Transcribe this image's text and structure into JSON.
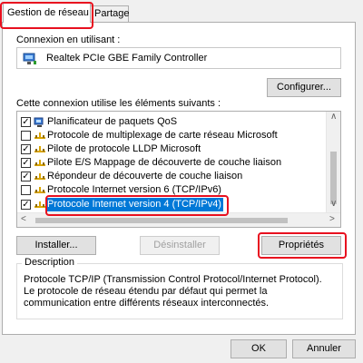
{
  "tabs": [
    {
      "label": "Gestion de réseau",
      "active": true
    },
    {
      "label": "Partage",
      "active": false
    }
  ],
  "connect_using": {
    "label": "Connexion en utilisant :",
    "adapter_name": "Realtek PCIe GBE Family Controller",
    "adapter_icon": "network-adapter-icon",
    "configure_button": "Configurer..."
  },
  "items": {
    "label": "Cette connexion utilise les éléments suivants :",
    "list": [
      {
        "label": "Planificateur de paquets QoS",
        "checked": true,
        "icon": "qos-scheduler-icon"
      },
      {
        "label": "Protocole de multiplexage de carte réseau Microsoft",
        "checked": false,
        "icon": "protocol-icon"
      },
      {
        "label": "Pilote de protocole LLDP Microsoft",
        "checked": true,
        "icon": "protocol-icon"
      },
      {
        "label": "Pilote E/S Mappage de découverte de couche liaison",
        "checked": true,
        "icon": "protocol-icon"
      },
      {
        "label": "Répondeur de découverte de couche liaison",
        "checked": true,
        "icon": "protocol-icon"
      },
      {
        "label": "Protocole Internet version 6 (TCP/IPv6)",
        "checked": false,
        "icon": "protocol-icon"
      },
      {
        "label": "Protocole Internet version 4 (TCP/IPv4)",
        "checked": true,
        "icon": "protocol-icon",
        "selected": true
      }
    ]
  },
  "actions": {
    "install": "Installer...",
    "uninstall": "Désinstaller",
    "properties": "Propriétés"
  },
  "description": {
    "title": "Description",
    "text": "Protocole TCP/IP (Transmission Control Protocol/Internet Protocol). Le protocole de réseau étendu par défaut qui permet la communication entre différents réseaux interconnectés."
  },
  "footer": {
    "ok": "OK",
    "cancel": "Annuler"
  },
  "colors": {
    "highlight": "#e8101f",
    "selection": "#0078d7"
  }
}
